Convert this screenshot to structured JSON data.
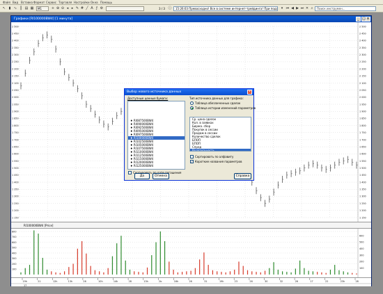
{
  "menubar": {
    "items": [
      "Файл",
      "Вид",
      "Вставка",
      "Формат",
      "Сервис",
      "Торговля",
      "Настройки",
      "Окна",
      "Помощь"
    ]
  },
  "toolbar": {
    "interval": "М1",
    "counter": "3 / 3",
    "status_message": "15:26:03  Превосходно! Все в системе интернет-трейдинга!   При подаче пор",
    "search_placeholder": "Поиск инструмен..."
  },
  "chart_window": {
    "title": "Графики  [RI100000BW4]  [1 минута]",
    "price_pane_label": "RI100000BW4 [Price]",
    "volume_pane_label": "RI100000BW4 [Volume]",
    "price_axis_ticks": [
      "2 500",
      "2 450",
      "2 400",
      "2 350",
      "2 300",
      "2 250",
      "2 200",
      "2 150",
      "2 100",
      "2 050",
      "2 000",
      "1 950",
      "1 900",
      "1 850",
      "1 800",
      "1 750",
      "1 700",
      "1 650",
      "1 600",
      "1 550",
      "1 500",
      "1 450",
      "1 400",
      "1 350",
      "1 300",
      "1 250",
      "1 200",
      "1 150"
    ],
    "volume_axis_ticks": [
      "800",
      "700",
      "600",
      "500",
      "400",
      "300",
      "200",
      "100"
    ],
    "volume_axis_ticks_right": [
      "600",
      "500",
      "400",
      "300",
      "200",
      "100"
    ],
    "time_labels": [
      "19h",
      "21",
      "12h",
      "13h",
      "26",
      "10h",
      "14h",
      "28",
      "13h",
      "2b",
      "16h",
      "26",
      "31",
      "19h",
      "23",
      "26",
      "30",
      "32",
      "26",
      "17",
      "22",
      "23h",
      "28"
    ],
    "date_label": "17"
  },
  "dialog": {
    "title": "Выбор нового источника данных",
    "available_label": "Доступные ценные бумаги:",
    "instruments": [
      "RI087500BW4",
      "RI090000BW4",
      "RI092500BW4",
      "RI095000BW4",
      "RI097500BW4",
      "RI100000BW4",
      "RI102500BW4",
      "RI105000BW4",
      "RI107500BW4",
      "RI110000BW4",
      "RI112500BW4",
      "RI115000BW4",
      "RI120000BW4",
      "RI125000BW4"
    ],
    "selected_instrument": "RI100000BW4",
    "sort_by_expiry": "Сортировать по дате погашения",
    "data_type_label": "Тип источника данных для графика:",
    "radio_options": [
      "Таблица обезличенных сделок",
      "Таблица истории изменений параметров"
    ],
    "parameters": [
      "Ср. цена сделок",
      "Кол. в заявках",
      "Биржа. сбор",
      "Покупок в сессии",
      "Продаж в сессии",
      "Количество сделок",
      "БПОП",
      "БПОП",
      "Спред",
      "Волатильность",
      "Теор. цена"
    ],
    "selected_parameter": "Волатильность",
    "sort_alpha": "Сортировать по алфавиту",
    "short_names": "Короткие названия параметров",
    "ok_label": "Да",
    "cancel_label": "Отмена",
    "help_label": "Справка"
  },
  "chart_data": {
    "type": "line",
    "series": [
      {
        "name": "RI100000BW4 [Price]",
        "y": [
          2080,
          2170,
          2260,
          2320,
          2380,
          2420,
          2440,
          2410,
          2340,
          2250,
          2180,
          2140,
          2100,
          2060,
          2010,
          1950,
          1920,
          1880,
          1840,
          1810,
          1790,
          1830,
          1870,
          1900,
          1930,
          1950,
          1920,
          1900,
          1880,
          1870,
          1900,
          1930,
          1950,
          1960,
          1940,
          1900,
          1850,
          1800,
          1760,
          1720,
          1700,
          1680,
          1660,
          1650,
          1640,
          1620,
          1600,
          1580,
          1560,
          1540,
          1520,
          1500,
          1450,
          1400,
          1340,
          1290,
          1250,
          1280,
          1330,
          1380,
          1420,
          1450,
          1460,
          1470,
          1480,
          1500,
          1520,
          1530,
          1520,
          1500,
          1490,
          1500,
          1520,
          1540,
          1550,
          1560,
          1540,
          1520
        ]
      },
      {
        "name": "RI100000BW4 [Volume]",
        "y": [
          40,
          120,
          180,
          820,
          760,
          310,
          90,
          60,
          40,
          30,
          60,
          140,
          200,
          480,
          620,
          390,
          160,
          80,
          60,
          40,
          120,
          340,
          580,
          720,
          260,
          90,
          60,
          50,
          40,
          130,
          360,
          600,
          800,
          620,
          240,
          90,
          40,
          50,
          60,
          70,
          120,
          280,
          410,
          180,
          80,
          60,
          50,
          40,
          60,
          90,
          240,
          160,
          80,
          60,
          50,
          40,
          70,
          120,
          230,
          90,
          60,
          50,
          40,
          110,
          260,
          120,
          70,
          60,
          50,
          40,
          30,
          90,
          180,
          80,
          60,
          40,
          30,
          20
        ]
      }
    ],
    "ylim": [
      1150,
      2500
    ],
    "y2lim": [
      0,
      800
    ],
    "grid": true,
    "colors": {
      "price": "#555555",
      "volume_up": "#2e8b2e",
      "volume_down": "#d63a2a"
    }
  }
}
